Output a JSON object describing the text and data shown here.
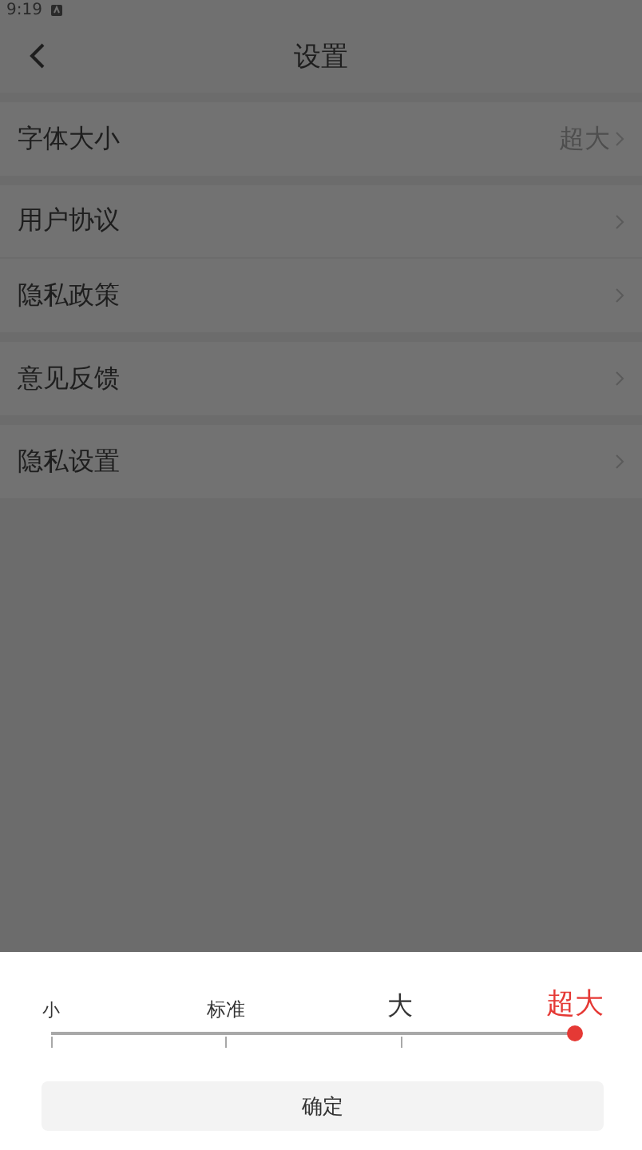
{
  "status_bar": {
    "time": "9:19"
  },
  "header": {
    "title": "设置"
  },
  "groups": [
    {
      "items": [
        {
          "label": "字体大小",
          "value": "超大"
        }
      ]
    },
    {
      "items": [
        {
          "label": "用户协议"
        },
        {
          "label": "隐私政策"
        }
      ]
    },
    {
      "items": [
        {
          "label": "意见反馈"
        }
      ]
    },
    {
      "items": [
        {
          "label": "隐私设置"
        }
      ]
    }
  ],
  "font_size_sheet": {
    "level": 1,
    "options": [
      {
        "label": "小",
        "selected": false
      },
      {
        "label": "标准",
        "selected": false
      },
      {
        "label": "大",
        "selected": false
      },
      {
        "label": "超大",
        "selected": true
      }
    ],
    "confirm": "确定"
  }
}
